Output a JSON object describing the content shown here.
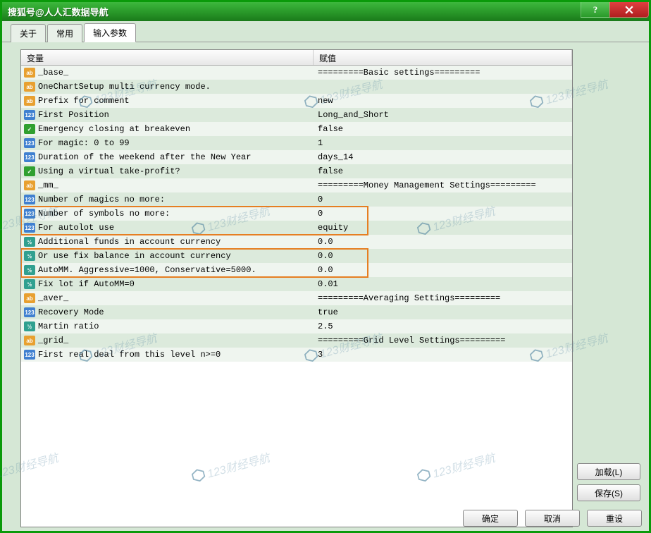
{
  "window": {
    "title": "搜狐号@人人汇数据导航"
  },
  "tabs": {
    "about": "关于",
    "common": "常用",
    "inputs": "输入参数"
  },
  "headers": {
    "var": "变量",
    "val": "赋值"
  },
  "rows": [
    {
      "type": "ab",
      "name": "_base_",
      "value": "=========Basic settings========="
    },
    {
      "type": "ab",
      "name": "OneChartSetup multi currency mode.",
      "value": ""
    },
    {
      "type": "ab",
      "name": "Prefix for comment",
      "value": "new"
    },
    {
      "type": "n123",
      "name": "First Position",
      "value": "Long_and_Short"
    },
    {
      "type": "bool",
      "name": "Emergency closing at breakeven",
      "value": "false"
    },
    {
      "type": "n123",
      "name": "For magic: 0 to 99",
      "value": "1"
    },
    {
      "type": "n123",
      "name": "Duration of the weekend after the New Year",
      "value": "days_14"
    },
    {
      "type": "bool",
      "name": "Using a virtual take-profit?",
      "value": "false"
    },
    {
      "type": "ab",
      "name": "_mm_",
      "value": "=========Money Management Settings========="
    },
    {
      "type": "n123",
      "name": "Number of magics no more:",
      "value": "0"
    },
    {
      "type": "n123",
      "name": "Number of symbols no more:",
      "value": "0"
    },
    {
      "type": "n123",
      "name": "For autolot use",
      "value": "equity"
    },
    {
      "type": "dbl",
      "name": "Additional funds in account currency",
      "value": "0.0"
    },
    {
      "type": "dbl",
      "name": "Or use fix balance in account currency",
      "value": "0.0"
    },
    {
      "type": "dbl",
      "name": "AutoMM. Aggressive=1000, Conservative=5000.",
      "value": "0.0"
    },
    {
      "type": "dbl",
      "name": "Fix lot if AutoMM=0",
      "value": "0.01"
    },
    {
      "type": "ab",
      "name": "_aver_",
      "value": "=========Averaging Settings========="
    },
    {
      "type": "n123",
      "name": "Recovery Mode",
      "value": "true"
    },
    {
      "type": "dbl",
      "name": "Martin ratio",
      "value": "2.5"
    },
    {
      "type": "ab",
      "name": "_grid_",
      "value": "=========Grid Level Settings========="
    },
    {
      "type": "n123",
      "name": "First real deal from this level n>=0",
      "value": "3"
    }
  ],
  "icon_labels": {
    "ab": "ab",
    "n123": "123",
    "bool": "✓",
    "dbl": "½"
  },
  "buttons": {
    "load": "加载(L)",
    "save": "保存(S)",
    "ok": "确定",
    "cancel": "取消",
    "reset": "重设",
    "help": "?"
  },
  "watermark": "123财经导航"
}
